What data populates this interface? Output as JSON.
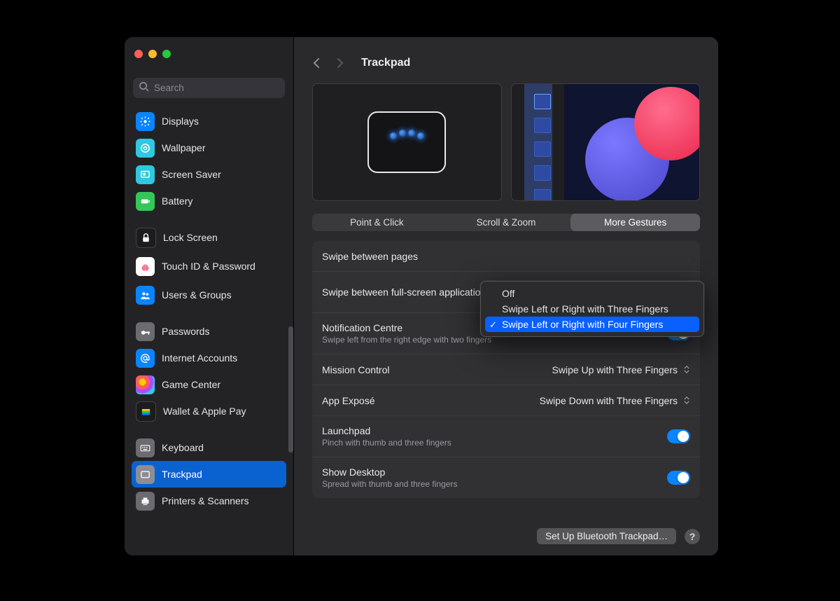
{
  "window": {
    "title": "Trackpad"
  },
  "search": {
    "placeholder": "Search"
  },
  "sidebar": {
    "groups": [
      [
        {
          "label": "Displays"
        },
        {
          "label": "Wallpaper"
        },
        {
          "label": "Screen Saver"
        },
        {
          "label": "Battery"
        }
      ],
      [
        {
          "label": "Lock Screen"
        },
        {
          "label": "Touch ID & Password"
        },
        {
          "label": "Users & Groups"
        }
      ],
      [
        {
          "label": "Passwords"
        },
        {
          "label": "Internet Accounts"
        },
        {
          "label": "Game Center"
        },
        {
          "label": "Wallet & Apple Pay"
        }
      ],
      [
        {
          "label": "Keyboard"
        },
        {
          "label": "Trackpad"
        },
        {
          "label": "Printers & Scanners"
        }
      ]
    ]
  },
  "tabs": {
    "items": [
      "Point & Click",
      "Scroll & Zoom",
      "More Gestures"
    ],
    "active": 2
  },
  "settings": {
    "swipe_pages": {
      "title": "Swipe between pages"
    },
    "swipe_fullscreen": {
      "title": "Swipe between full-screen applications"
    },
    "notification_centre": {
      "title": "Notification Centre",
      "subtitle": "Swipe left from the right edge with two fingers"
    },
    "mission_control": {
      "title": "Mission Control",
      "value": "Swipe Up with Three Fingers"
    },
    "app_expose": {
      "title": "App Exposé",
      "value": "Swipe Down with Three Fingers"
    },
    "launchpad": {
      "title": "Launchpad",
      "subtitle": "Pinch with thumb and three fingers"
    },
    "show_desktop": {
      "title": "Show Desktop",
      "subtitle": "Spread with thumb and three fingers"
    }
  },
  "dropdown": {
    "options": [
      "Off",
      "Swipe Left or Right with Three Fingers",
      "Swipe Left or Right with Four Fingers"
    ],
    "selected_index": 2
  },
  "footer": {
    "setup_button": "Set Up Bluetooth Trackpad…",
    "help": "?"
  }
}
